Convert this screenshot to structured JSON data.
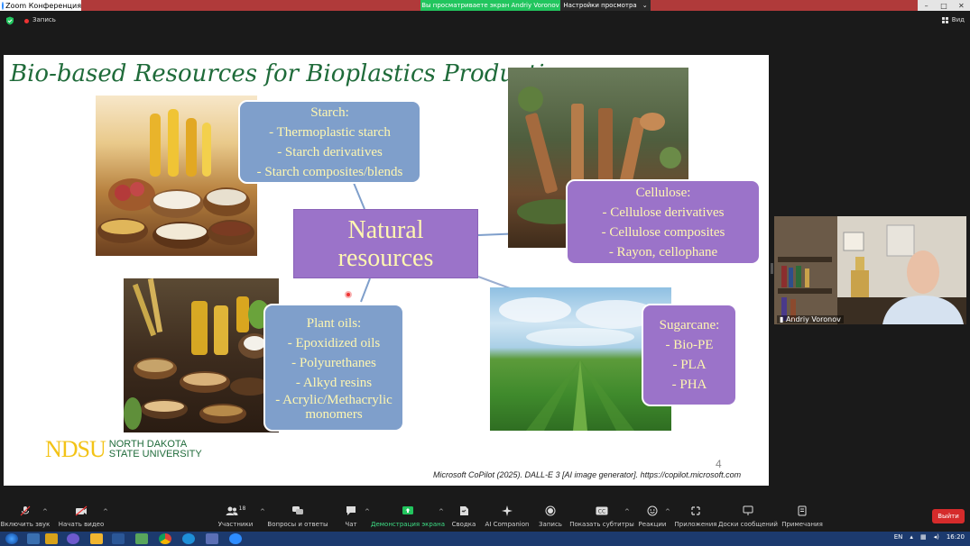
{
  "window": {
    "title": "Zoom Конференция",
    "share_banner": "Вы просматриваете экран Andriy Voronov",
    "view_settings": "Настройки просмотра",
    "controls": [
      "–",
      "□",
      "✕"
    ]
  },
  "meeting_bar": {
    "recording_label": "Запись",
    "view_label": "Вид"
  },
  "slide": {
    "title": "Bio-based Resources for Bioplastics Production",
    "center": [
      "Natural",
      "resources"
    ],
    "boxes": {
      "starch": {
        "title": "Starch:",
        "items": [
          "- Thermoplastic starch",
          "- Starch derivatives",
          "- Starch composites/blends"
        ]
      },
      "cellulose": {
        "title": "Cellulose:",
        "items": [
          "- Cellulose derivatives",
          "- Cellulose composites",
          "- Rayon, cellophane"
        ]
      },
      "plant_oils": {
        "title": "Plant oils:",
        "items": [
          "- Epoxidized oils",
          "- Polyurethanes",
          "- Alkyd resins",
          "- Acrylic/Methacrylic",
          "monomers"
        ]
      },
      "sugarcane": {
        "title": "Sugarcane:",
        "items": [
          "- Bio-PE",
          "- PLA",
          "- PHA"
        ]
      }
    },
    "ndsu_big": "NDSU",
    "ndsu_small": [
      "NORTH DAKOTA",
      "STATE UNIVERSITY"
    ],
    "slide_number": "4",
    "credit": "Microsoft CoPilot (2025). DALL-E 3 [AI image generator].  https://copilot.microsoft.com",
    "colors": {
      "title": "#1f6b3a",
      "box_blue": "#7f9fcb",
      "box_purple": "#9b73c9",
      "box_text": "#fff7b0",
      "ndsu_gold": "#f3c316"
    }
  },
  "participant": {
    "name": "Andriy Voronov"
  },
  "toolbar": {
    "mute": "Включить звук",
    "video": "Начать видео",
    "participants": "Участники",
    "participants_count": "18",
    "qa": "Вопросы и ответы",
    "chat": "Чат",
    "share": "Демонстрация экрана",
    "summary": "Сводка",
    "ai": "AI Companion",
    "record": "Запись",
    "captions": "Показать субтитры",
    "reactions": "Реакции",
    "apps": "Приложения",
    "whiteboards": "Доски сообщений",
    "notes": "Примечания",
    "leave": "Выйти"
  },
  "taskbar": {
    "lang": "EN",
    "time": "16:20"
  }
}
